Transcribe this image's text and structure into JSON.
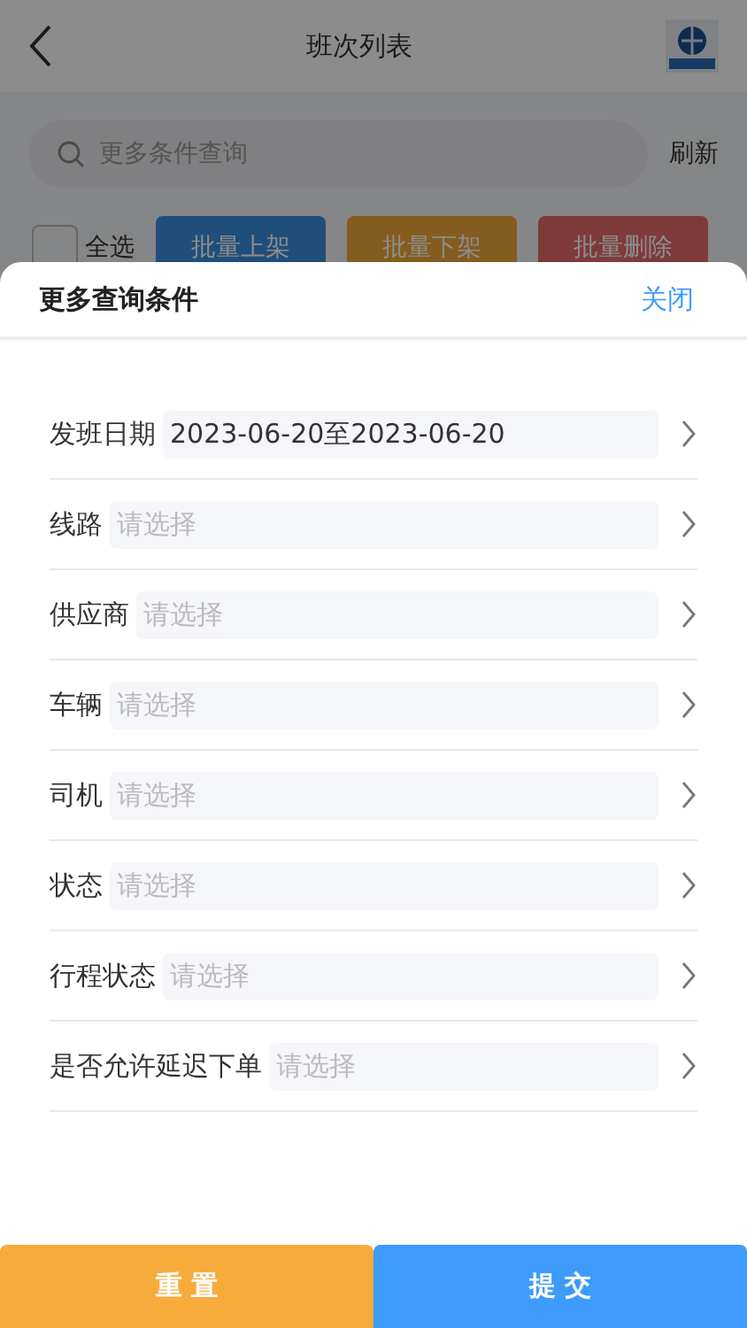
{
  "header": {
    "title": "班次列表"
  },
  "search": {
    "placeholder": "更多条件查询",
    "refresh": "刷新"
  },
  "batch_bar": {
    "select_all": {
      "label": "全选",
      "checked": false
    },
    "buttons": [
      {
        "label": "批量上架",
        "kind": "blue"
      },
      {
        "label": "批量下架",
        "kind": "orange"
      },
      {
        "label": "批量删除",
        "kind": "red"
      }
    ]
  },
  "sheet": {
    "title": "更多查询条件",
    "close": "关闭",
    "fields": [
      {
        "label": "发班日期",
        "value": "2023-06-20至2023-06-20"
      },
      {
        "label": "线路",
        "placeholder": "请选择"
      },
      {
        "label": "供应商",
        "placeholder": "请选择"
      },
      {
        "label": "车辆",
        "placeholder": "请选择"
      },
      {
        "label": "司机",
        "placeholder": "请选择"
      },
      {
        "label": "状态",
        "placeholder": "请选择"
      },
      {
        "label": "行程状态",
        "placeholder": "请选择"
      },
      {
        "label": "是否允许延迟下单",
        "placeholder": "请选择"
      }
    ],
    "actions": [
      {
        "label": "重 置",
        "kind": "reset"
      },
      {
        "label": "提 交",
        "kind": "submit"
      }
    ]
  }
}
